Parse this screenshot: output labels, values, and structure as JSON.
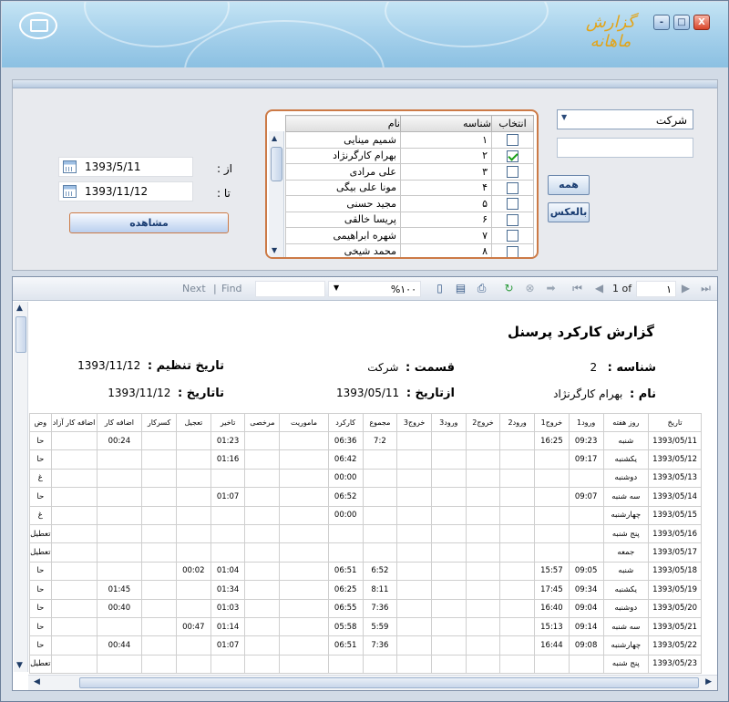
{
  "window": {
    "title": "گزارش ماهانه",
    "min_label": "-",
    "max_label": "□",
    "close_label": "X"
  },
  "filters": {
    "company_select": "شرکت",
    "all_button": "همه",
    "invert_button": "بالعکس",
    "columns": {
      "select": "انتخاب",
      "id": "شناسه",
      "name": "نام"
    },
    "employees": [
      {
        "id": "۱",
        "name": "شمیم مینایی",
        "checked": false
      },
      {
        "id": "۲",
        "name": "بهرام کارگرنژاد",
        "checked": true
      },
      {
        "id": "۳",
        "name": "علی مرادی",
        "checked": false
      },
      {
        "id": "۴",
        "name": "مونا علی بیگی",
        "checked": false
      },
      {
        "id": "۵",
        "name": "مجید حسنی",
        "checked": false
      },
      {
        "id": "۶",
        "name": "پریسا خالقی",
        "checked": false
      },
      {
        "id": "۷",
        "name": "شهره ابراهیمی",
        "checked": false
      },
      {
        "id": "۸",
        "name": "محمد شیخی",
        "checked": false
      }
    ],
    "from_label": "از :",
    "to_label": "تا :",
    "from_date": "1393/5/11",
    "to_date": "1393/11/12",
    "view_button": "مشاهده"
  },
  "toolbar": {
    "next": "Next",
    "separator": "|",
    "find": "Find",
    "zoom": "%۱۰۰",
    "page_current": "۱",
    "page_of": "1 of"
  },
  "report": {
    "title": "گزارش کارکرد پرسنل",
    "id_label": "شناسه :",
    "id_value": "2",
    "dept_label": "قسمت :",
    "dept_value": "شرکت",
    "issue_label": "تاریخ تنظیم :",
    "issue_value": "1393/11/12",
    "name_label": "نام :",
    "name_value": "بهرام کارگرنژاد",
    "from_label": "ازتاریخ :",
    "from_value": "1393/05/11",
    "to_label": "تاتاریخ :",
    "to_value": "1393/11/12",
    "columns": [
      "تاریخ",
      "روز هفته",
      "ورود1",
      "خروج1",
      "ورود2",
      "خروج2",
      "ورود3",
      "خروج3",
      "مجموع",
      "کارکرد",
      "ماموریت",
      "مرخصی",
      "تاخیر",
      "تعجیل",
      "کسرکار",
      "اضافه کار",
      "اضافه کار آزاد",
      "وض"
    ],
    "rows": [
      [
        "1393/05/11",
        "شنبه",
        "09:23",
        "16:25",
        "",
        "",
        "",
        "",
        "7:2",
        "06:36",
        "",
        "",
        "01:23",
        "",
        "",
        "00:24",
        "",
        "حا"
      ],
      [
        "1393/05/12",
        "یکشنبه",
        "09:17",
        "",
        "",
        "",
        "",
        "",
        "",
        "06:42",
        "",
        "",
        "01:16",
        "",
        "",
        "",
        "",
        "حا"
      ],
      [
        "1393/05/13",
        "دوشنبه",
        "",
        "",
        "",
        "",
        "",
        "",
        "",
        "00:00",
        "",
        "",
        "",
        "",
        "",
        "",
        "",
        "غ"
      ],
      [
        "1393/05/14",
        "سه شنبه",
        "09:07",
        "",
        "",
        "",
        "",
        "",
        "",
        "06:52",
        "",
        "",
        "01:07",
        "",
        "",
        "",
        "",
        "حا"
      ],
      [
        "1393/05/15",
        "چهارشنبه",
        "",
        "",
        "",
        "",
        "",
        "",
        "",
        "00:00",
        "",
        "",
        "",
        "",
        "",
        "",
        "",
        "غ"
      ],
      [
        "1393/05/16",
        "پنج شنبه",
        "",
        "",
        "",
        "",
        "",
        "",
        "",
        "",
        "",
        "",
        "",
        "",
        "",
        "",
        "",
        "تعطیل"
      ],
      [
        "1393/05/17",
        "جمعه",
        "",
        "",
        "",
        "",
        "",
        "",
        "",
        "",
        "",
        "",
        "",
        "",
        "",
        "",
        "",
        "تعطیل"
      ],
      [
        "1393/05/18",
        "شنبه",
        "09:05",
        "15:57",
        "",
        "",
        "",
        "",
        "6:52",
        "06:51",
        "",
        "",
        "01:04",
        "00:02",
        "",
        "",
        "",
        "حا"
      ],
      [
        "1393/05/19",
        "یکشنبه",
        "09:34",
        "17:45",
        "",
        "",
        "",
        "",
        "8:11",
        "06:25",
        "",
        "",
        "01:34",
        "",
        "",
        "01:45",
        "",
        "حا"
      ],
      [
        "1393/05/20",
        "دوشنبه",
        "09:04",
        "16:40",
        "",
        "",
        "",
        "",
        "7:36",
        "06:55",
        "",
        "",
        "01:03",
        "",
        "",
        "00:40",
        "",
        "حا"
      ],
      [
        "1393/05/21",
        "سه شنبه",
        "09:14",
        "15:13",
        "",
        "",
        "",
        "",
        "5:59",
        "05:58",
        "",
        "",
        "01:14",
        "00:47",
        "",
        "",
        "",
        "حا"
      ],
      [
        "1393/05/22",
        "چهارشنبه",
        "09:08",
        "16:44",
        "",
        "",
        "",
        "",
        "7:36",
        "06:51",
        "",
        "",
        "01:07",
        "",
        "",
        "00:44",
        "",
        "حا"
      ],
      [
        "1393/05/23",
        "پنج شنبه",
        "",
        "",
        "",
        "",
        "",
        "",
        "",
        "",
        "",
        "",
        "",
        "",
        "",
        "",
        "",
        "تعطیل"
      ]
    ]
  }
}
